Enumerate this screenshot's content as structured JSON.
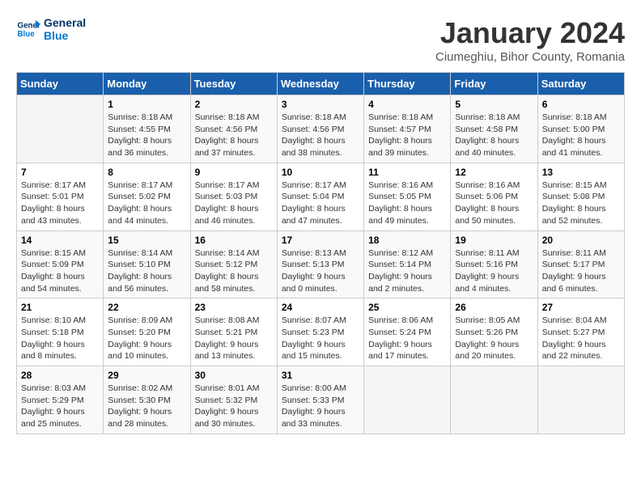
{
  "logo": {
    "line1": "General",
    "line2": "Blue"
  },
  "title": "January 2024",
  "subtitle": "Ciumeghiu, Bihor County, Romania",
  "days_of_week": [
    "Sunday",
    "Monday",
    "Tuesday",
    "Wednesday",
    "Thursday",
    "Friday",
    "Saturday"
  ],
  "weeks": [
    [
      {
        "num": "",
        "info": ""
      },
      {
        "num": "1",
        "info": "Sunrise: 8:18 AM\nSunset: 4:55 PM\nDaylight: 8 hours\nand 36 minutes."
      },
      {
        "num": "2",
        "info": "Sunrise: 8:18 AM\nSunset: 4:56 PM\nDaylight: 8 hours\nand 37 minutes."
      },
      {
        "num": "3",
        "info": "Sunrise: 8:18 AM\nSunset: 4:56 PM\nDaylight: 8 hours\nand 38 minutes."
      },
      {
        "num": "4",
        "info": "Sunrise: 8:18 AM\nSunset: 4:57 PM\nDaylight: 8 hours\nand 39 minutes."
      },
      {
        "num": "5",
        "info": "Sunrise: 8:18 AM\nSunset: 4:58 PM\nDaylight: 8 hours\nand 40 minutes."
      },
      {
        "num": "6",
        "info": "Sunrise: 8:18 AM\nSunset: 5:00 PM\nDaylight: 8 hours\nand 41 minutes."
      }
    ],
    [
      {
        "num": "7",
        "info": "Sunrise: 8:17 AM\nSunset: 5:01 PM\nDaylight: 8 hours\nand 43 minutes."
      },
      {
        "num": "8",
        "info": "Sunrise: 8:17 AM\nSunset: 5:02 PM\nDaylight: 8 hours\nand 44 minutes."
      },
      {
        "num": "9",
        "info": "Sunrise: 8:17 AM\nSunset: 5:03 PM\nDaylight: 8 hours\nand 46 minutes."
      },
      {
        "num": "10",
        "info": "Sunrise: 8:17 AM\nSunset: 5:04 PM\nDaylight: 8 hours\nand 47 minutes."
      },
      {
        "num": "11",
        "info": "Sunrise: 8:16 AM\nSunset: 5:05 PM\nDaylight: 8 hours\nand 49 minutes."
      },
      {
        "num": "12",
        "info": "Sunrise: 8:16 AM\nSunset: 5:06 PM\nDaylight: 8 hours\nand 50 minutes."
      },
      {
        "num": "13",
        "info": "Sunrise: 8:15 AM\nSunset: 5:08 PM\nDaylight: 8 hours\nand 52 minutes."
      }
    ],
    [
      {
        "num": "14",
        "info": "Sunrise: 8:15 AM\nSunset: 5:09 PM\nDaylight: 8 hours\nand 54 minutes."
      },
      {
        "num": "15",
        "info": "Sunrise: 8:14 AM\nSunset: 5:10 PM\nDaylight: 8 hours\nand 56 minutes."
      },
      {
        "num": "16",
        "info": "Sunrise: 8:14 AM\nSunset: 5:12 PM\nDaylight: 8 hours\nand 58 minutes."
      },
      {
        "num": "17",
        "info": "Sunrise: 8:13 AM\nSunset: 5:13 PM\nDaylight: 9 hours\nand 0 minutes."
      },
      {
        "num": "18",
        "info": "Sunrise: 8:12 AM\nSunset: 5:14 PM\nDaylight: 9 hours\nand 2 minutes."
      },
      {
        "num": "19",
        "info": "Sunrise: 8:11 AM\nSunset: 5:16 PM\nDaylight: 9 hours\nand 4 minutes."
      },
      {
        "num": "20",
        "info": "Sunrise: 8:11 AM\nSunset: 5:17 PM\nDaylight: 9 hours\nand 6 minutes."
      }
    ],
    [
      {
        "num": "21",
        "info": "Sunrise: 8:10 AM\nSunset: 5:18 PM\nDaylight: 9 hours\nand 8 minutes."
      },
      {
        "num": "22",
        "info": "Sunrise: 8:09 AM\nSunset: 5:20 PM\nDaylight: 9 hours\nand 10 minutes."
      },
      {
        "num": "23",
        "info": "Sunrise: 8:08 AM\nSunset: 5:21 PM\nDaylight: 9 hours\nand 13 minutes."
      },
      {
        "num": "24",
        "info": "Sunrise: 8:07 AM\nSunset: 5:23 PM\nDaylight: 9 hours\nand 15 minutes."
      },
      {
        "num": "25",
        "info": "Sunrise: 8:06 AM\nSunset: 5:24 PM\nDaylight: 9 hours\nand 17 minutes."
      },
      {
        "num": "26",
        "info": "Sunrise: 8:05 AM\nSunset: 5:26 PM\nDaylight: 9 hours\nand 20 minutes."
      },
      {
        "num": "27",
        "info": "Sunrise: 8:04 AM\nSunset: 5:27 PM\nDaylight: 9 hours\nand 22 minutes."
      }
    ],
    [
      {
        "num": "28",
        "info": "Sunrise: 8:03 AM\nSunset: 5:29 PM\nDaylight: 9 hours\nand 25 minutes."
      },
      {
        "num": "29",
        "info": "Sunrise: 8:02 AM\nSunset: 5:30 PM\nDaylight: 9 hours\nand 28 minutes."
      },
      {
        "num": "30",
        "info": "Sunrise: 8:01 AM\nSunset: 5:32 PM\nDaylight: 9 hours\nand 30 minutes."
      },
      {
        "num": "31",
        "info": "Sunrise: 8:00 AM\nSunset: 5:33 PM\nDaylight: 9 hours\nand 33 minutes."
      },
      {
        "num": "",
        "info": ""
      },
      {
        "num": "",
        "info": ""
      },
      {
        "num": "",
        "info": ""
      }
    ]
  ]
}
